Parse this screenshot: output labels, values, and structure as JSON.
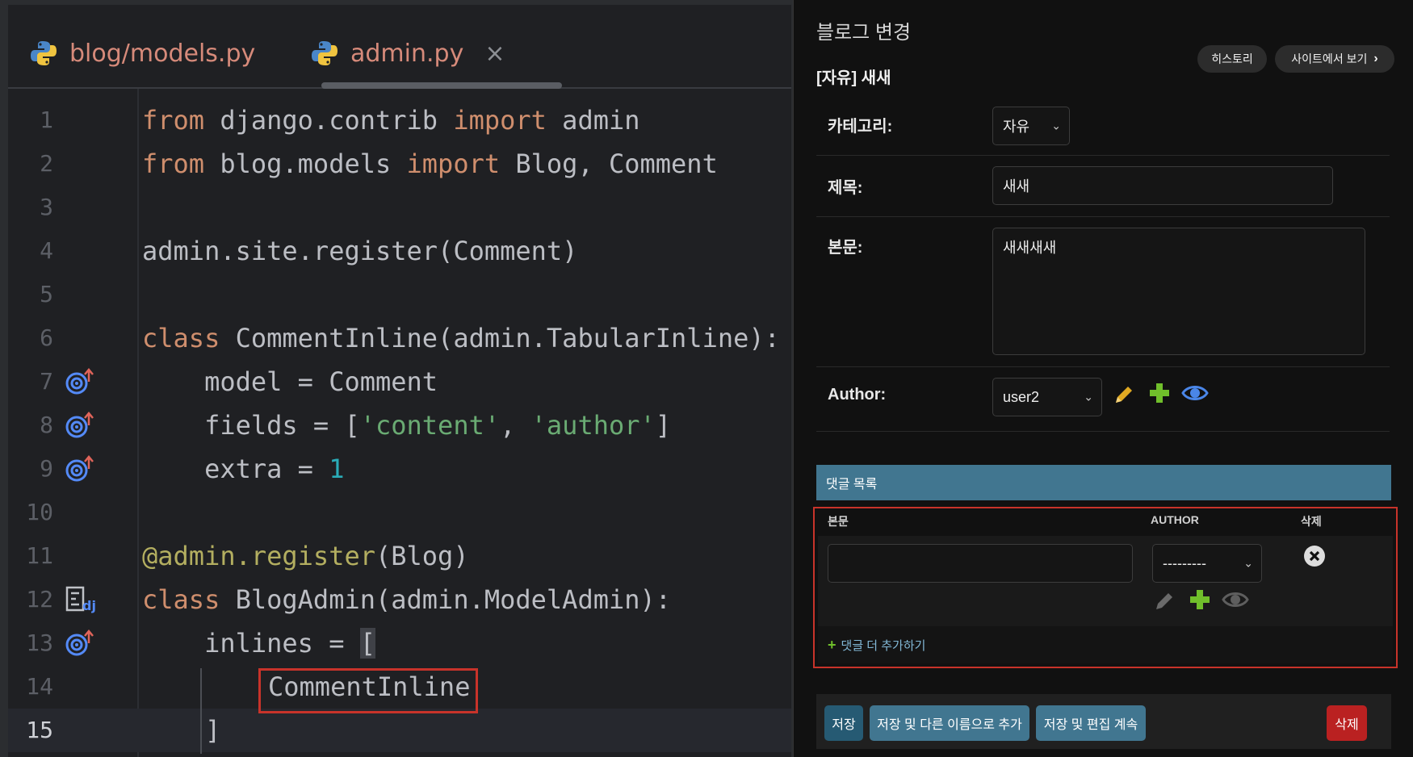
{
  "editor": {
    "tabs": [
      {
        "label": "blog/models.py",
        "icon": "python-icon"
      },
      {
        "label": "admin.py",
        "icon": "python-icon",
        "close": "×"
      }
    ],
    "lines": [
      {
        "num": "1"
      },
      {
        "num": "2"
      },
      {
        "num": "3"
      },
      {
        "num": "4"
      },
      {
        "num": "5"
      },
      {
        "num": "6"
      },
      {
        "num": "7"
      },
      {
        "num": "8"
      },
      {
        "num": "9"
      },
      {
        "num": "10"
      },
      {
        "num": "11"
      },
      {
        "num": "12"
      },
      {
        "num": "13"
      },
      {
        "num": "14"
      },
      {
        "num": "15"
      }
    ],
    "tokens": {
      "from": "from",
      "import": "import",
      "class": "class",
      "django_contrib": " django.contrib ",
      "admin_name": " admin",
      "blog_models": " blog.models ",
      "blog_comment": " Blog, Comment",
      "register_comment": "admin.site.register(Comment)",
      "comment_inline_decl": " CommentInline(admin.TabularInline):",
      "model_line": "    model = Comment",
      "fields_prefix": "    fields = [",
      "str_content": "'content'",
      "comma": ", ",
      "str_author": "'author'",
      "fields_suffix": "]",
      "extra_prefix": "    extra = ",
      "one": "1",
      "decorator": "@admin.register",
      "decorator_arg": "(Blog)",
      "blogadmin_decl": " BlogAdmin(admin.ModelAdmin):",
      "inlines_prefix": "    inlines = ",
      "open_bracket": "[",
      "comment_inline_ref": "CommentInline",
      "close_bracket": "]"
    }
  },
  "admin": {
    "page_title": "블로그 변경",
    "object_title": "[자유] 새새",
    "history_label": "히스토리",
    "view_site_label": "사이트에서 보기",
    "category": {
      "label": "카테고리:",
      "value": "자유"
    },
    "title": {
      "label": "제목:",
      "value": "새새"
    },
    "content": {
      "label": "본문:",
      "value": "새새새새"
    },
    "author": {
      "label": "Author:",
      "value": "user2"
    },
    "inline": {
      "header": "댓글 목록",
      "col_content": "본문",
      "col_author": "AUTHOR",
      "col_delete": "삭제",
      "author_placeholder": "---------",
      "add_another": "댓글 더 추가하기"
    },
    "buttons": {
      "save": "저장",
      "save_as_new": "저장 및 다른 이름으로 추가",
      "save_continue": "저장 및 편집 계속",
      "delete": "삭제"
    },
    "colors": {
      "accent": "#417690",
      "delete": "#ba2121",
      "add": "#70bf2b",
      "highlight": "#c8332a"
    }
  }
}
